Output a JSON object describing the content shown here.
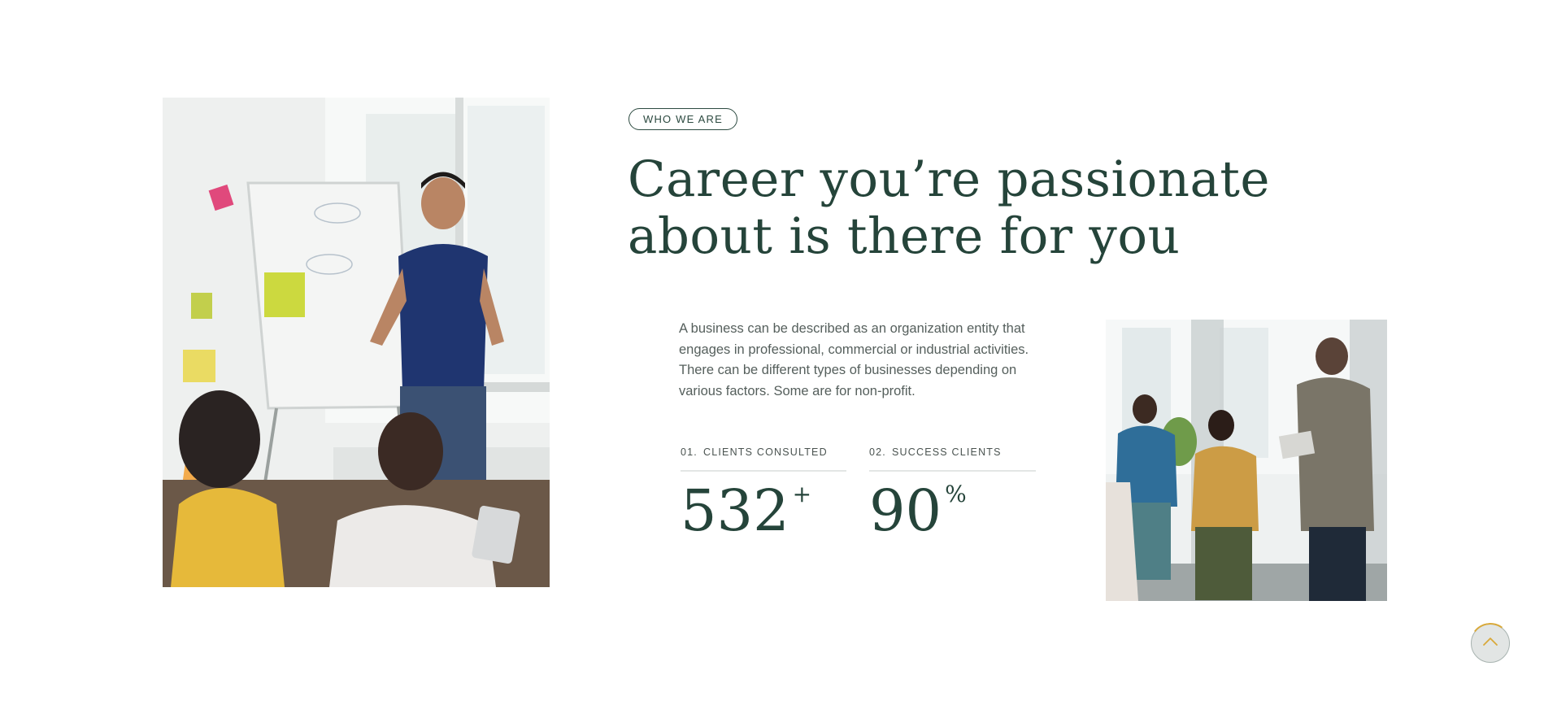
{
  "section": {
    "tag_label": "WHO WE ARE",
    "heading_line1": "Career you’re passionate",
    "heading_line2": "about is there for you",
    "description": "A business can be described as an organization entity that engages in professional, commercial or industrial activities. There can be different types of businesses depending on various factors. Some are for non-profit."
  },
  "stats": [
    {
      "index": "01.",
      "label": "CLIENTS CONSULTED",
      "value": "532",
      "suffix": "+"
    },
    {
      "index": "02.",
      "label": "SUCCESS CLIENTS",
      "value": "90",
      "suffix": "%"
    }
  ],
  "icons": {
    "scroll_top": "chevron-up-icon"
  },
  "colors": {
    "heading": "#25443a",
    "accent": "#d9a93a",
    "body_text": "#555f5c"
  }
}
